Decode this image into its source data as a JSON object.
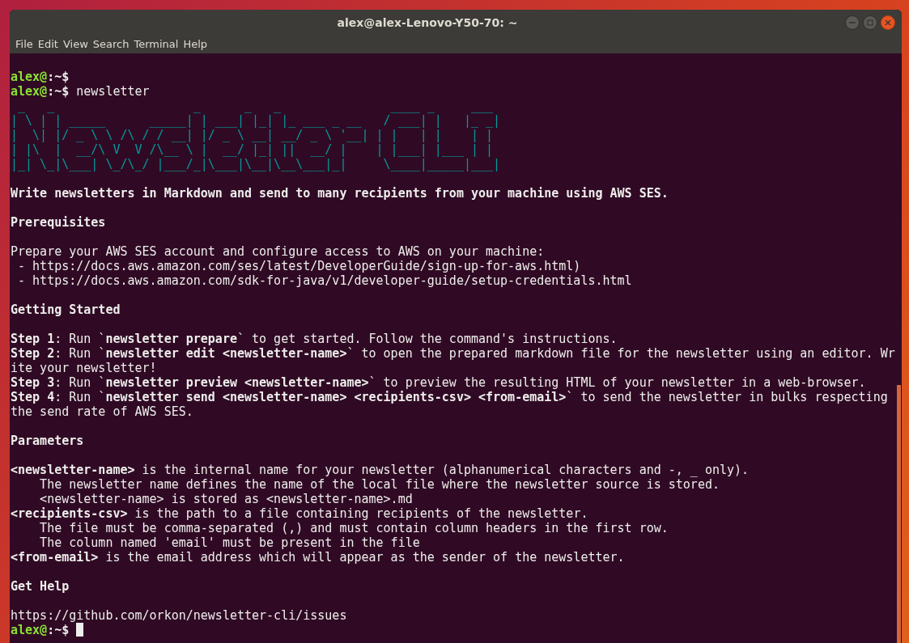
{
  "window": {
    "title": "alex@alex-Lenovo-Y50-70: ~"
  },
  "menu": [
    "File",
    "Edit",
    "View",
    "Search",
    "Terminal",
    "Help"
  ],
  "terminal": {
    "lines": [
      {
        "kind": "prompt",
        "user": "alex@",
        "path": ":~$"
      },
      {
        "kind": "prompt",
        "user": "alex@",
        "path": ":~$",
        "command": " newsletter"
      },
      {
        "kind": "ascii",
        "text": " _   _                   _      _   _               ____ _     ___ "
      },
      {
        "kind": "ascii",
        "text": "| \\ | | _____      _____| | ___| |_| |_ ___ _ __   / ___| |   |_ _|"
      },
      {
        "kind": "ascii",
        "text": "|  \\| |/ _ \\ \\ /\\ / / __| |/ _ \\ __| __/ _ \\ '__| | |   | |    | | "
      },
      {
        "kind": "ascii",
        "text": "| |\\  |  __/\\ V  V /\\__ \\ |  __/ |_| ||  __/ |    | |___| |___ | | "
      },
      {
        "kind": "ascii",
        "text": "|_| \\_|\\___| \\_/\\_/ |___/_|\\___|\\__|\\__\\___|_|     \\____|_____|___|"
      },
      {
        "kind": "blank"
      },
      {
        "kind": "text",
        "text": "Write newsletters in Markdown and send to many recipients from your machine using AWS SES.",
        "bold": true
      },
      {
        "kind": "blank"
      },
      {
        "kind": "text",
        "text": "Prerequisites",
        "bold": true
      },
      {
        "kind": "blank"
      },
      {
        "kind": "text",
        "text": "Prepare your AWS SES account and configure access to AWS on your machine:",
        "bold": false
      },
      {
        "kind": "text",
        "text": " - https://docs.aws.amazon.com/ses/latest/DeveloperGuide/sign-up-for-aws.html)",
        "bold": false
      },
      {
        "kind": "text",
        "text": " - https://docs.aws.amazon.com/sdk-for-java/v1/developer-guide/setup-credentials.html",
        "bold": false
      },
      {
        "kind": "blank"
      },
      {
        "kind": "text",
        "text": "Getting Started",
        "bold": true
      },
      {
        "kind": "blank"
      },
      {
        "kind": "text",
        "text": "**Step 1**: Run `**newsletter prepare**` to get started. Follow the command's instructions.",
        "bold": false
      },
      {
        "kind": "text",
        "text": "**Step 2**: Run `**newsletter edit <newsletter-name>**` to open the prepared markdown file for the newsletter using an editor. Wr",
        "bold": false
      },
      {
        "kind": "text",
        "text": "ite your newsletter!",
        "bold": false
      },
      {
        "kind": "text",
        "text": "**Step 3**: Run `**newsletter preview <newsletter-name>**` to preview the resulting HTML of your newsletter in a web-browser.",
        "bold": false
      },
      {
        "kind": "text",
        "text": "**Step 4**: Run `**newsletter send <newsletter-name> <recipients-csv> <from-email>**` to send the newsletter in bulks respecting",
        "bold": false
      },
      {
        "kind": "text",
        "text": "the send rate of AWS SES.",
        "bold": false
      },
      {
        "kind": "blank"
      },
      {
        "kind": "text",
        "text": "Parameters",
        "bold": true
      },
      {
        "kind": "blank"
      },
      {
        "kind": "text",
        "text": "**<newsletter-name>** is the internal name for your newsletter (alphanumerical characters and -, _ only).",
        "bold": false
      },
      {
        "kind": "text",
        "text": "    The newsletter name defines the name of the local file where the newsletter source is stored.",
        "bold": false
      },
      {
        "kind": "text",
        "text": "    <newsletter-name> is stored as <newsletter-name>.md",
        "bold": false
      },
      {
        "kind": "text",
        "text": "**<recipients-csv>** is the path to a file containing recipients of the newsletter.",
        "bold": false
      },
      {
        "kind": "text",
        "text": "    The file must be comma-separated (,) and must contain column headers in the first row.",
        "bold": false
      },
      {
        "kind": "text",
        "text": "    The column named 'email' must be present in the file",
        "bold": false
      },
      {
        "kind": "text",
        "text": "**<from-email>** is the email address which will appear as the sender of the newsletter.",
        "bold": false
      },
      {
        "kind": "blank"
      },
      {
        "kind": "text",
        "text": "Get Help",
        "bold": true
      },
      {
        "kind": "blank"
      },
      {
        "kind": "text",
        "text": "https://github.com/orkon/newsletter-cli/issues",
        "bold": false
      },
      {
        "kind": "prompt",
        "user": "alex@",
        "path": ":~$",
        "cursor": true
      }
    ]
  }
}
